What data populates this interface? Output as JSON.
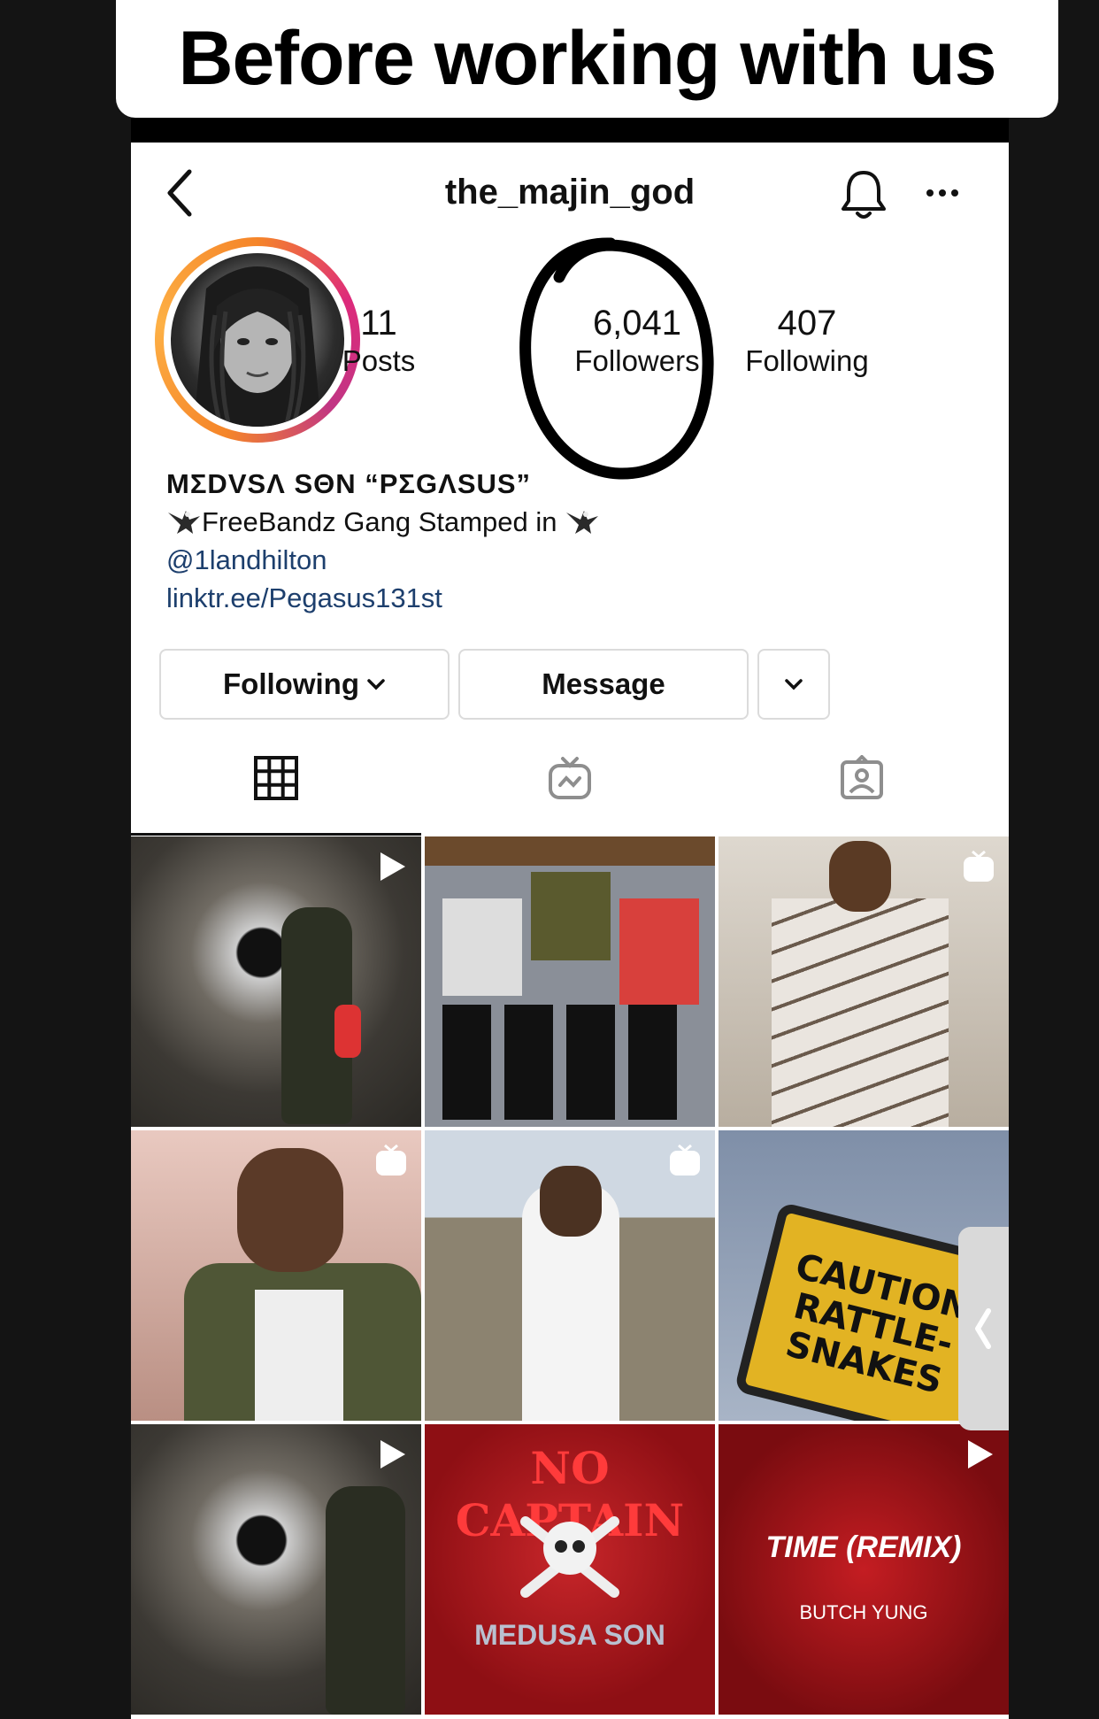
{
  "banner": {
    "text": "Before working with us"
  },
  "profile": {
    "username": "the_majin_god",
    "stats": [
      {
        "value": "11",
        "label": "Posts"
      },
      {
        "value": "6,041",
        "label": "Followers"
      },
      {
        "value": "407",
        "label": "Following"
      }
    ],
    "display_name": "MΣDVSΛ SΘN “PΣGΛSUS”",
    "bio_line": "FreeBandz Gang Stamped in",
    "mention": "@1landhilton",
    "link": "linktr.ee/Pegasus131st"
  },
  "actions": {
    "following": "Following",
    "message": "Message"
  },
  "posts": [
    {
      "type": "video",
      "text": ""
    },
    {
      "type": "photo",
      "text": ""
    },
    {
      "type": "igtv",
      "text": ""
    },
    {
      "type": "igtv",
      "text": ""
    },
    {
      "type": "igtv",
      "text": ""
    },
    {
      "type": "photo",
      "text": "CAUTION RATTLE-SNAKES"
    },
    {
      "type": "video",
      "text": ""
    },
    {
      "type": "photo",
      "text": "NO CAPTAIN",
      "sub": "MEDUSA SON"
    },
    {
      "type": "video",
      "text": "TIME (REMIX)",
      "sub": "BUTCH YUNG"
    }
  ],
  "icons": {
    "back": "chevron-left-icon",
    "bell": "bell-icon",
    "more": "more-icon",
    "grid": "grid-icon",
    "igtv": "igtv-icon",
    "tagged": "tagged-icon"
  },
  "colors": {
    "link": "#1d3f6d",
    "background": "#141414"
  }
}
